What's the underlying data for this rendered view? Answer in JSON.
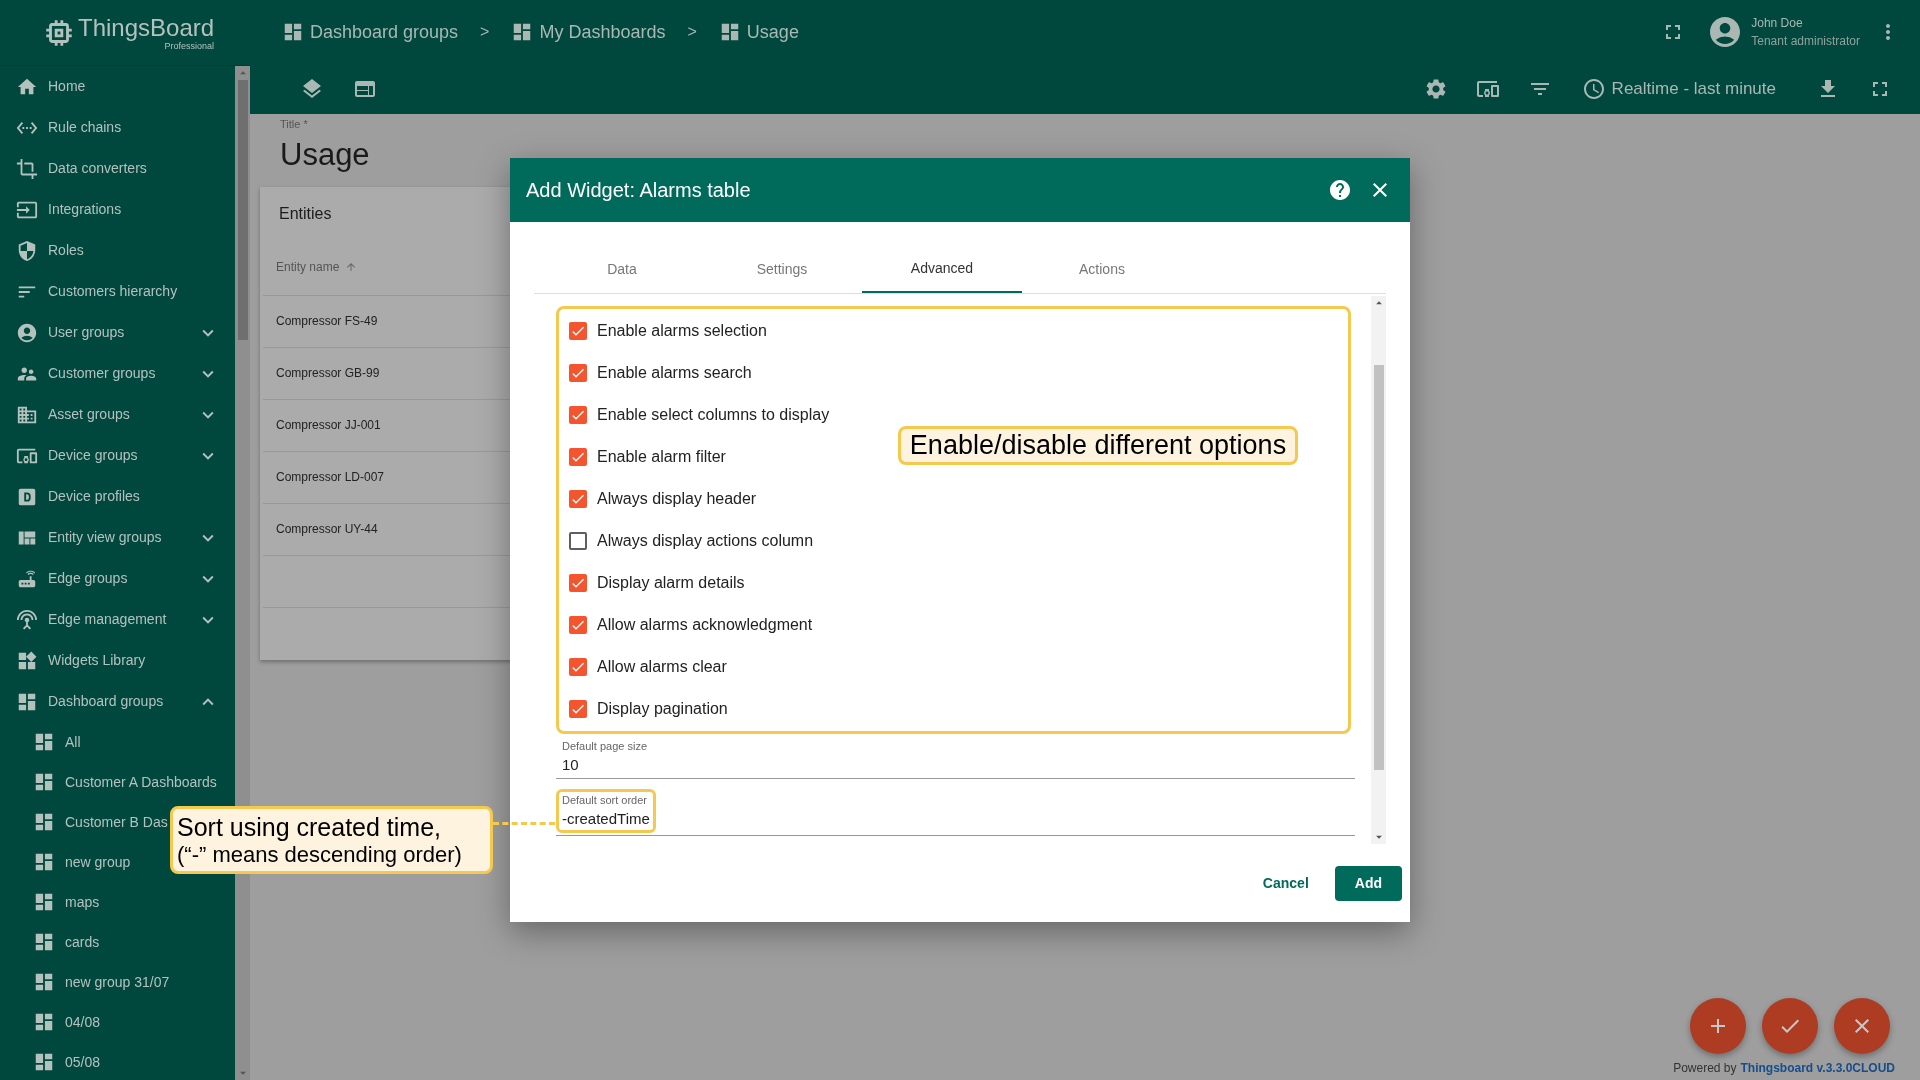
{
  "logo": {
    "name": "ThingsBoard",
    "edition": "Professional"
  },
  "breadcrumbs": [
    {
      "label": "Dashboard groups"
    },
    {
      "label": "My Dashboards"
    },
    {
      "label": "Usage"
    }
  ],
  "breadcrumb_separators": [
    ">",
    ">"
  ],
  "user": {
    "name": "John Doe",
    "role": "Tenant administrator"
  },
  "timewindow": "Realtime - last minute",
  "sidebar": {
    "items": [
      {
        "label": "Home",
        "kind": "link"
      },
      {
        "label": "Rule chains",
        "kind": "link"
      },
      {
        "label": "Data converters",
        "kind": "link"
      },
      {
        "label": "Integrations",
        "kind": "link"
      },
      {
        "label": "Roles",
        "kind": "link"
      },
      {
        "label": "Customers hierarchy",
        "kind": "link"
      },
      {
        "label": "User groups",
        "kind": "group",
        "expanded": false
      },
      {
        "label": "Customer groups",
        "kind": "group",
        "expanded": false
      },
      {
        "label": "Asset groups",
        "kind": "group",
        "expanded": false
      },
      {
        "label": "Device groups",
        "kind": "group",
        "expanded": false
      },
      {
        "label": "Device profiles",
        "kind": "link"
      },
      {
        "label": "Entity view groups",
        "kind": "group",
        "expanded": false
      },
      {
        "label": "Edge groups",
        "kind": "group",
        "expanded": false
      },
      {
        "label": "Edge management",
        "kind": "group",
        "expanded": false
      },
      {
        "label": "Widgets Library",
        "kind": "link"
      },
      {
        "label": "Dashboard groups",
        "kind": "group",
        "expanded": true,
        "children": [
          {
            "label": "All"
          },
          {
            "label": "Customer A Dashboards"
          },
          {
            "label": "Customer B Das"
          },
          {
            "label": "new group"
          },
          {
            "label": "maps"
          },
          {
            "label": "cards"
          },
          {
            "label": "new group 31/07"
          },
          {
            "label": "04/08"
          },
          {
            "label": "05/08"
          }
        ]
      }
    ]
  },
  "dashboard": {
    "title_label": "Title *",
    "title": "Usage",
    "widget": {
      "title": "Entities",
      "column": "Entity name",
      "rows": [
        "Compressor FS-49",
        "Compressor GB-99",
        "Compressor JJ-001",
        "Compressor LD-007",
        "Compressor UY-44"
      ]
    }
  },
  "dialog": {
    "title": "Add Widget: Alarms table",
    "tabs": [
      {
        "label": "Data",
        "selected": false
      },
      {
        "label": "Settings",
        "selected": false
      },
      {
        "label": "Advanced",
        "selected": true
      },
      {
        "label": "Actions",
        "selected": false
      }
    ],
    "options": [
      {
        "label": "Enable alarms selection",
        "checked": true
      },
      {
        "label": "Enable alarms search",
        "checked": true
      },
      {
        "label": "Enable select columns to display",
        "checked": true
      },
      {
        "label": "Enable alarm filter",
        "checked": true
      },
      {
        "label": "Always display header",
        "checked": true
      },
      {
        "label": "Always display actions column",
        "checked": false
      },
      {
        "label": "Display alarm details",
        "checked": true
      },
      {
        "label": "Allow alarms acknowledgment",
        "checked": true
      },
      {
        "label": "Allow alarms clear",
        "checked": true
      },
      {
        "label": "Display pagination",
        "checked": true
      }
    ],
    "fields": [
      {
        "label": "Default page size",
        "value": "10"
      },
      {
        "label": "Default sort order",
        "value": "-createdTime"
      }
    ],
    "buttons": [
      {
        "label": "Cancel",
        "kind": "text"
      },
      {
        "label": "Add",
        "kind": "primary"
      }
    ]
  },
  "annotations": [
    {
      "lines": [
        "Enable/disable different options"
      ]
    },
    {
      "lines": [
        "Sort using created time,",
        "(“-” means descending order)"
      ]
    }
  ],
  "fabs": [
    {
      "kind": "add"
    },
    {
      "kind": "apply"
    },
    {
      "kind": "cancel"
    }
  ],
  "footer": {
    "prefix": "Powered by",
    "link": "Thingsboard v.3.3.0CLOUD"
  }
}
